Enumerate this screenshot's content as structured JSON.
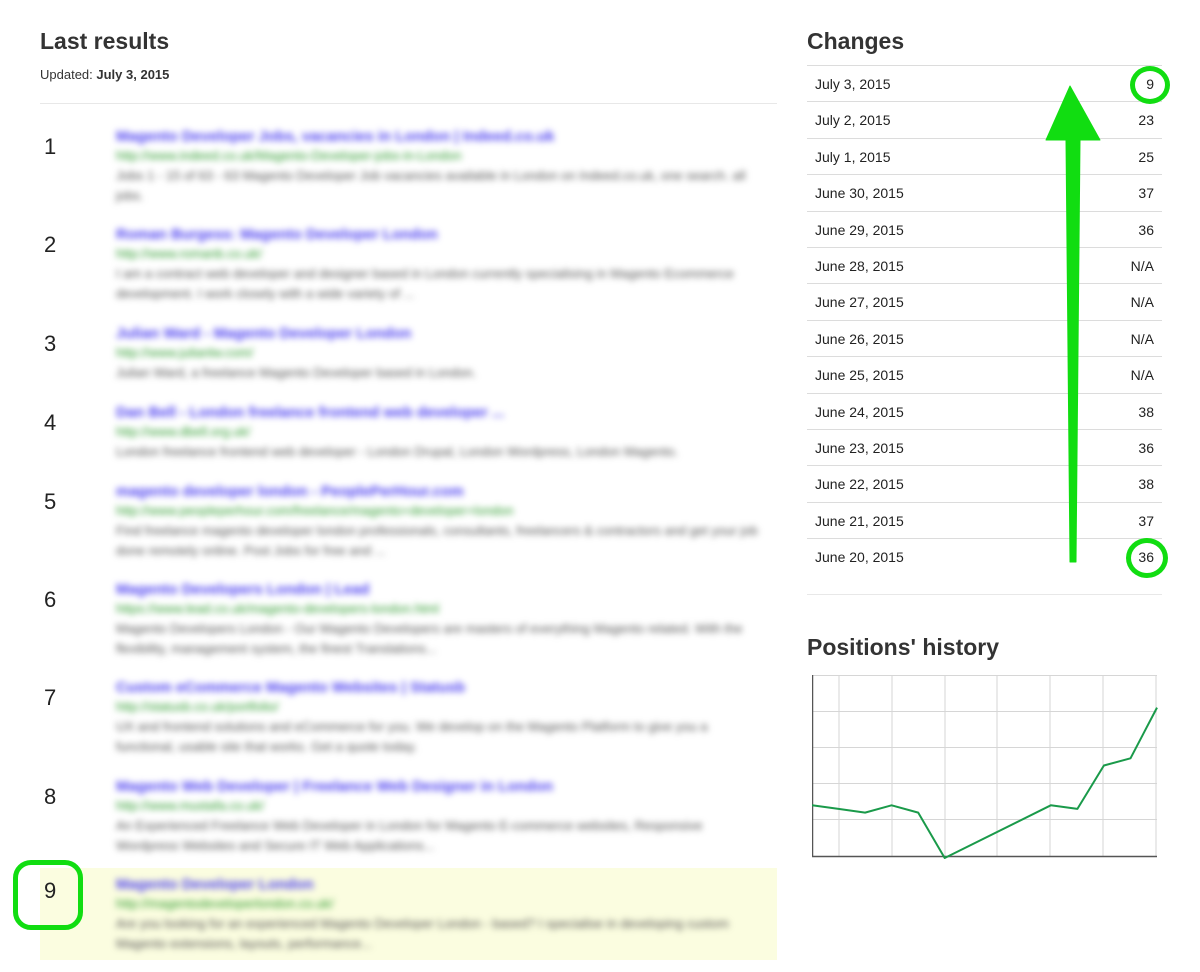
{
  "left": {
    "title": "Last results",
    "updated_label": "Updated:",
    "updated_date": "July 3, 2015",
    "results": [
      {
        "num": "1",
        "title": "Magento Developer Jobs, vacancies in London | Indeed.co.uk",
        "url": "http://www.indeed.co.uk/Magento-Developer-jobs-in-London",
        "desc": "Jobs 1 - 15 of 63 - 63 Magento Developer Job vacancies available in London on Indeed.co.uk, one search. all jobs."
      },
      {
        "num": "2",
        "title": "Roman Burgess: Magento Developer London",
        "url": "http://www.romanb.co.uk/",
        "desc": "I am a contract web developer and designer based in London currently specialising in Magento Ecommerce development. I work closely with a wide variety of ..."
      },
      {
        "num": "3",
        "title": "Julian Ward - Magento Developer London",
        "url": "http://www.julianlw.com/",
        "desc": "Julian Ward, a freelance Magento Developer based in London."
      },
      {
        "num": "4",
        "title": "Dan Bell - London freelance frontend web developer ...",
        "url": "http://www.dbell.org.uk/",
        "desc": "London freelance frontend web developer - London Drupal, London Wordpress, London Magento."
      },
      {
        "num": "5",
        "title": "magento developer london - PeoplePerHour.com",
        "url": "http://www.peopleperhour.com/freelance/magento+developer+london",
        "desc": "Find freelance magento developer london professionals, consultants, freelancers & contractors and get your job done remotely online. Post Jobs for free and ..."
      },
      {
        "num": "6",
        "title": "Magento Developers London | Lead",
        "url": "https://www.lead.co.uk/magento-developers-london.html",
        "desc": "Magento Developers London - Our Magento Developers are masters of everything Magento related. With the flexibility, management system, the finest Translations..."
      },
      {
        "num": "7",
        "title": "Custom eCommerce Magento Websites | Statusb",
        "url": "http://statusb.co.uk/portfolio/",
        "desc": "UX and frontend solutions and eCommerce for you. We develop on the Magento Platform to give you a functional, usable site that works. Get a quote today."
      },
      {
        "num": "8",
        "title": "Magento Web Developer | Freelance Web Designer in London",
        "url": "http://www.mustafa.co.uk/",
        "desc": "An Experienced Freelance Web Developer in London for Magento E-commerce websites, Responsive Wordpress Websites and Secure IT Web Applications..."
      },
      {
        "num": "9",
        "title": "Magento Developer London",
        "url": "http://magentodeveloperlondon.co.uk/",
        "desc": "Are you looking for an experienced Magento Developer London - based? I specialise in developing custom Magento extensions, layouts, performance..."
      }
    ]
  },
  "changes": {
    "title": "Changes",
    "rows": [
      {
        "date": "July 3, 2015",
        "value": "9"
      },
      {
        "date": "July 2, 2015",
        "value": "23"
      },
      {
        "date": "July 1, 2015",
        "value": "25"
      },
      {
        "date": "June 30, 2015",
        "value": "37"
      },
      {
        "date": "June 29, 2015",
        "value": "36"
      },
      {
        "date": "June 28, 2015",
        "value": "N/A"
      },
      {
        "date": "June 27, 2015",
        "value": "N/A"
      },
      {
        "date": "June 26, 2015",
        "value": "N/A"
      },
      {
        "date": "June 25, 2015",
        "value": "N/A"
      },
      {
        "date": "June 24, 2015",
        "value": "38"
      },
      {
        "date": "June 23, 2015",
        "value": "36"
      },
      {
        "date": "June 22, 2015",
        "value": "38"
      },
      {
        "date": "June 21, 2015",
        "value": "37"
      },
      {
        "date": "June 20, 2015",
        "value": "36"
      }
    ]
  },
  "history": {
    "title": "Positions' history",
    "line_color": "#1a9a4a"
  },
  "annotation": {
    "color": "#11dd11"
  },
  "chart_data": {
    "type": "line",
    "x": [
      "June 20, 2015",
      "June 21, 2015",
      "June 22, 2015",
      "June 23, 2015",
      "June 24, 2015",
      "June 25, 2015",
      "June 26, 2015",
      "June 27, 2015",
      "June 28, 2015",
      "June 29, 2015",
      "June 30, 2015",
      "July 1, 2015",
      "July 2, 2015",
      "July 3, 2015"
    ],
    "series": [
      {
        "values": [
          36,
          37,
          38,
          36,
          38,
          null,
          null,
          null,
          null,
          36,
          37,
          25,
          23,
          9
        ]
      }
    ],
    "inverted_y": true,
    "ylim": [
      0,
      50
    ],
    "grid": true
  }
}
